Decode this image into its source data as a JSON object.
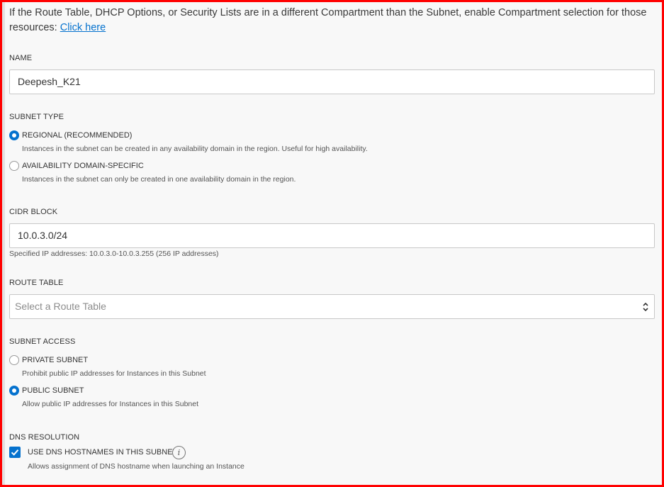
{
  "intro": {
    "text": "If the Route Table, DHCP Options, or Security Lists are in a different Compartment than the Subnet, enable Compartment selection for those resources: ",
    "link": "Click here"
  },
  "name": {
    "label": "NAME",
    "value": "Deepesh_K21"
  },
  "subnet_type": {
    "label": "SUBNET TYPE",
    "options": [
      {
        "label": "REGIONAL (RECOMMENDED)",
        "help": "Instances in the subnet can be created in any availability domain in the region. Useful for high availability.",
        "checked": true
      },
      {
        "label": "AVAILABILITY DOMAIN-SPECIFIC",
        "help": "Instances in the subnet can only be created in one availability domain in the region.",
        "checked": false
      }
    ]
  },
  "cidr": {
    "label": "CIDR BLOCK",
    "value": "10.0.3.0/24",
    "help": "Specified IP addresses: 10.0.3.0-10.0.3.255 (256 IP addresses)"
  },
  "route_table": {
    "label": "ROUTE TABLE",
    "placeholder": "Select a Route Table"
  },
  "subnet_access": {
    "label": "SUBNET ACCESS",
    "options": [
      {
        "label": "PRIVATE SUBNET",
        "help": "Prohibit public IP addresses for Instances in this Subnet",
        "checked": false
      },
      {
        "label": "PUBLIC SUBNET",
        "help": "Allow public IP addresses for Instances in this Subnet",
        "checked": true
      }
    ]
  },
  "dns": {
    "label": "DNS RESOLUTION",
    "checkbox_label": "USE DNS HOSTNAMES IN THIS SUBNET",
    "info_glyph": "i",
    "help": "Allows assignment of DNS hostname when launching an Instance",
    "checked": true
  },
  "colors": {
    "accent": "#0572ce",
    "highlight_border": "#ff0000",
    "panel_bg": "#f8f8f8"
  }
}
